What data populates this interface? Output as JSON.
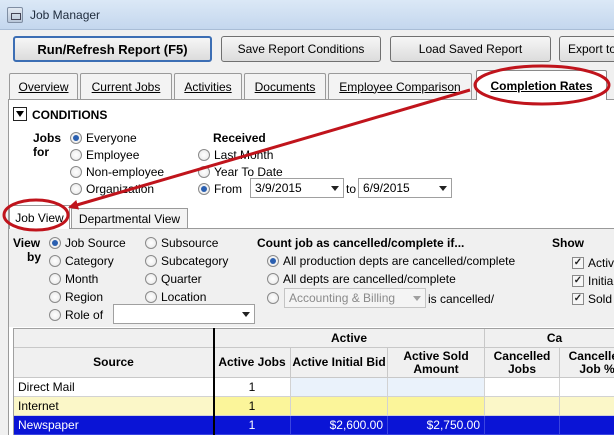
{
  "window": {
    "title": "Job Manager"
  },
  "toolbar": {
    "run": "Run/Refresh Report (F5)",
    "save": "Save Report Conditions",
    "load": "Load Saved Report",
    "export": "Export to"
  },
  "tabs": [
    "Overview",
    "Current Jobs",
    "Activities",
    "Documents",
    "Employee Comparison",
    "Completion Rates"
  ],
  "conditions": {
    "header": "CONDITIONS",
    "jobs_for_label_1": "Jobs",
    "jobs_for_label_2": "for",
    "jobs_for_options": [
      "Everyone",
      "Employee",
      "Non-employee",
      "Organization"
    ],
    "received_label": "Received",
    "received_options": [
      "Last Month",
      "Year To Date",
      "From"
    ],
    "from_date": "3/9/2015",
    "to_label": "to",
    "to_date": "6/9/2015"
  },
  "subtabs": [
    "Job View",
    "Departmental View"
  ],
  "view_by": {
    "label_1": "View",
    "label_2": "by",
    "col1": [
      "Job Source",
      "Category",
      "Month",
      "Region",
      "Role of"
    ],
    "col2": [
      "Subsource",
      "Subcategory",
      "Quarter",
      "Location"
    ]
  },
  "count": {
    "header": "Count job as cancelled/complete if...",
    "options": [
      "All production depts are cancelled/complete",
      "All depts are cancelled/complete"
    ],
    "dept_select": "Accounting & Billing",
    "dept_suffix": "is cancelled/"
  },
  "show": {
    "header": "Show",
    "items": [
      "Active",
      "Initial",
      "Sold"
    ]
  },
  "table": {
    "group_active": "Active",
    "group_cancelled": "Ca",
    "columns": [
      "Source",
      "Active Jobs",
      "Active Initial Bid",
      "Active Sold Amount",
      "Cancelled Jobs",
      "Cancelled Job %"
    ],
    "rows": [
      {
        "source": "Direct Mail",
        "jobs": "1",
        "initial": "",
        "sold": ""
      },
      {
        "source": "Internet",
        "jobs": "1",
        "initial": "",
        "sold": ""
      },
      {
        "source": "Newspaper",
        "jobs": "1",
        "initial": "$2,600.00",
        "sold": "$2,750.00"
      }
    ]
  },
  "colors": {
    "accent_red": "#c0141c",
    "selection": "#0a14d6",
    "highlight": "#fbf7a4"
  }
}
